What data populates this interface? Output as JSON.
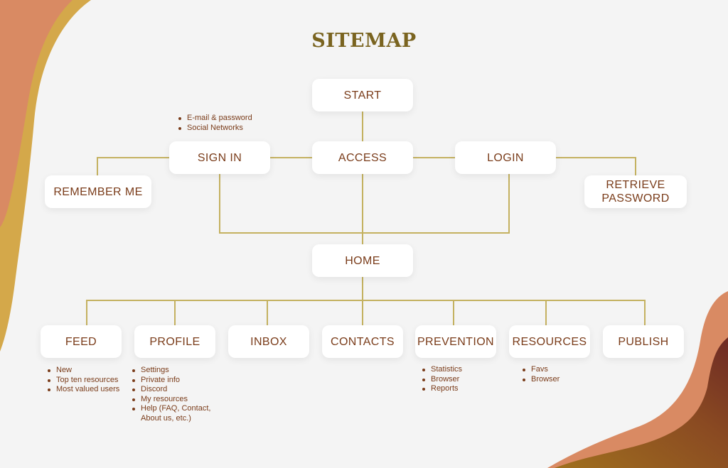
{
  "title": "SITEMAP",
  "colors": {
    "background": "#f4f4f4",
    "title": "#7a6420",
    "node_text": "#7a3c1a",
    "connector": "#c4b160",
    "accent_orange": "#d98a63",
    "accent_gold": "#d4a84a",
    "accent_brown": "#7a3020"
  },
  "nodes": {
    "start": {
      "label": "START"
    },
    "access": {
      "label": "ACCESS"
    },
    "sign_in": {
      "label": "SIGN IN",
      "notes": [
        "E-mail & password",
        "Social Networks"
      ]
    },
    "login": {
      "label": "LOGIN"
    },
    "remember_me": {
      "label": "REMEMBER ME"
    },
    "retrieve_password": {
      "label": "RETRIEVE PASSWORD",
      "line1": "RETRIEVE",
      "line2": "PASSWORD"
    },
    "home": {
      "label": "HOME"
    },
    "feed": {
      "label": "FEED",
      "notes": [
        "New",
        "Top ten resources",
        "Most valued users"
      ]
    },
    "profile": {
      "label": "PROFILE",
      "notes": [
        "Settings",
        "Private info",
        "Discord",
        "My resources",
        "Help (FAQ, Contact, About us, etc.)"
      ]
    },
    "inbox": {
      "label": "INBOX"
    },
    "contacts": {
      "label": "CONTACTS"
    },
    "prevention": {
      "label": "PREVENTION",
      "notes": [
        "Statistics",
        "Browser",
        "Reports"
      ]
    },
    "resources": {
      "label": "RESOURCES",
      "notes": [
        "Favs",
        "Browser"
      ]
    },
    "publish": {
      "label": "PUBLISH"
    }
  },
  "edges": [
    [
      "start",
      "access"
    ],
    [
      "access",
      "sign_in"
    ],
    [
      "access",
      "login"
    ],
    [
      "sign_in",
      "remember_me"
    ],
    [
      "login",
      "retrieve_password"
    ],
    [
      "access",
      "home"
    ],
    [
      "sign_in",
      "home"
    ],
    [
      "login",
      "home"
    ],
    [
      "home",
      "feed"
    ],
    [
      "home",
      "profile"
    ],
    [
      "home",
      "inbox"
    ],
    [
      "home",
      "contacts"
    ],
    [
      "home",
      "prevention"
    ],
    [
      "home",
      "resources"
    ],
    [
      "home",
      "publish"
    ]
  ]
}
